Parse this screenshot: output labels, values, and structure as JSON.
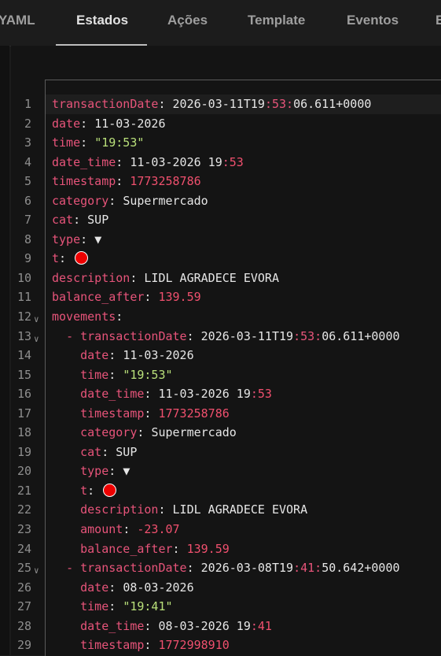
{
  "tabs": [
    {
      "label": "YAML",
      "active": false
    },
    {
      "label": "Estados",
      "active": true
    },
    {
      "label": "Ações",
      "active": false
    },
    {
      "label": "Template",
      "active": false
    },
    {
      "label": "Eventos",
      "active": false
    },
    {
      "label": "E",
      "active": false
    }
  ],
  "colors": {
    "key": "#e7547a",
    "string": "#b9e07a",
    "number": "#f0506e",
    "text": "#e6e6e6",
    "dot": "#ee0000"
  },
  "lines": [
    {
      "n": "1",
      "active": true,
      "tokens": [
        [
          "k",
          "transactionDate"
        ],
        [
          "p",
          ": "
        ],
        [
          "t",
          "2026-03-11T19"
        ],
        [
          "k",
          ":53:"
        ],
        [
          "t",
          "06.611+0000"
        ]
      ]
    },
    {
      "n": "2",
      "tokens": [
        [
          "k",
          "date"
        ],
        [
          "p",
          ": "
        ],
        [
          "t",
          "11-03-2026"
        ]
      ]
    },
    {
      "n": "3",
      "tokens": [
        [
          "k",
          "time"
        ],
        [
          "p",
          ": "
        ],
        [
          "s",
          "\"19:53\""
        ]
      ]
    },
    {
      "n": "4",
      "tokens": [
        [
          "k",
          "date_time"
        ],
        [
          "p",
          ": "
        ],
        [
          "t",
          "11-03-2026 19"
        ],
        [
          "k",
          ":"
        ],
        [
          "n",
          "53"
        ]
      ]
    },
    {
      "n": "5",
      "tokens": [
        [
          "k",
          "timestamp"
        ],
        [
          "p",
          ": "
        ],
        [
          "n",
          "1773258786"
        ]
      ]
    },
    {
      "n": "6",
      "tokens": [
        [
          "k",
          "category"
        ],
        [
          "p",
          ": "
        ],
        [
          "t",
          "Supermercado"
        ]
      ]
    },
    {
      "n": "7",
      "tokens": [
        [
          "k",
          "cat"
        ],
        [
          "p",
          ": "
        ],
        [
          "t",
          "SUP"
        ]
      ]
    },
    {
      "n": "8",
      "tokens": [
        [
          "k",
          "type"
        ],
        [
          "p",
          ": "
        ],
        [
          "t",
          "▼"
        ]
      ]
    },
    {
      "n": "9",
      "tokens": [
        [
          "k",
          "t"
        ],
        [
          "p",
          ": "
        ],
        [
          "dot",
          ""
        ]
      ]
    },
    {
      "n": "10",
      "tokens": [
        [
          "k",
          "description"
        ],
        [
          "p",
          ": "
        ],
        [
          "t",
          "LIDL AGRADECE EVORA"
        ]
      ]
    },
    {
      "n": "11",
      "tokens": [
        [
          "k",
          "balance_after"
        ],
        [
          "p",
          ": "
        ],
        [
          "n",
          "139.59"
        ]
      ]
    },
    {
      "n": "12",
      "fold": true,
      "tokens": [
        [
          "k",
          "movements"
        ],
        [
          "p",
          ":"
        ]
      ]
    },
    {
      "n": "13",
      "fold": true,
      "tokens": [
        [
          "p",
          "  "
        ],
        [
          "dash",
          "- "
        ],
        [
          "k",
          "transactionDate"
        ],
        [
          "p",
          ": "
        ],
        [
          "t",
          "2026-03-11T19"
        ],
        [
          "k",
          ":53:"
        ],
        [
          "t",
          "06.611+0000"
        ]
      ]
    },
    {
      "n": "14",
      "tokens": [
        [
          "p",
          "    "
        ],
        [
          "k",
          "date"
        ],
        [
          "p",
          ": "
        ],
        [
          "t",
          "11-03-2026"
        ]
      ]
    },
    {
      "n": "15",
      "tokens": [
        [
          "p",
          "    "
        ],
        [
          "k",
          "time"
        ],
        [
          "p",
          ": "
        ],
        [
          "s",
          "\"19:53\""
        ]
      ]
    },
    {
      "n": "16",
      "tokens": [
        [
          "p",
          "    "
        ],
        [
          "k",
          "date_time"
        ],
        [
          "p",
          ": "
        ],
        [
          "t",
          "11-03-2026 19"
        ],
        [
          "k",
          ":"
        ],
        [
          "n",
          "53"
        ]
      ]
    },
    {
      "n": "17",
      "tokens": [
        [
          "p",
          "    "
        ],
        [
          "k",
          "timestamp"
        ],
        [
          "p",
          ": "
        ],
        [
          "n",
          "1773258786"
        ]
      ]
    },
    {
      "n": "18",
      "tokens": [
        [
          "p",
          "    "
        ],
        [
          "k",
          "category"
        ],
        [
          "p",
          ": "
        ],
        [
          "t",
          "Supermercado"
        ]
      ]
    },
    {
      "n": "19",
      "tokens": [
        [
          "p",
          "    "
        ],
        [
          "k",
          "cat"
        ],
        [
          "p",
          ": "
        ],
        [
          "t",
          "SUP"
        ]
      ]
    },
    {
      "n": "20",
      "tokens": [
        [
          "p",
          "    "
        ],
        [
          "k",
          "type"
        ],
        [
          "p",
          ": "
        ],
        [
          "t",
          "▼"
        ]
      ]
    },
    {
      "n": "21",
      "tokens": [
        [
          "p",
          "    "
        ],
        [
          "k",
          "t"
        ],
        [
          "p",
          ": "
        ],
        [
          "dot",
          ""
        ]
      ]
    },
    {
      "n": "22",
      "tokens": [
        [
          "p",
          "    "
        ],
        [
          "k",
          "description"
        ],
        [
          "p",
          ": "
        ],
        [
          "t",
          "LIDL AGRADECE EVORA"
        ]
      ]
    },
    {
      "n": "23",
      "tokens": [
        [
          "p",
          "    "
        ],
        [
          "k",
          "amount"
        ],
        [
          "p",
          ": "
        ],
        [
          "n",
          "-23.07"
        ]
      ]
    },
    {
      "n": "24",
      "tokens": [
        [
          "p",
          "    "
        ],
        [
          "k",
          "balance_after"
        ],
        [
          "p",
          ": "
        ],
        [
          "n",
          "139.59"
        ]
      ]
    },
    {
      "n": "25",
      "fold": true,
      "tokens": [
        [
          "p",
          "  "
        ],
        [
          "dash",
          "- "
        ],
        [
          "k",
          "transactionDate"
        ],
        [
          "p",
          ": "
        ],
        [
          "t",
          "2026-03-08T19"
        ],
        [
          "k",
          ":41:"
        ],
        [
          "t",
          "50.642+0000"
        ]
      ]
    },
    {
      "n": "26",
      "tokens": [
        [
          "p",
          "    "
        ],
        [
          "k",
          "date"
        ],
        [
          "p",
          ": "
        ],
        [
          "t",
          "08-03-2026"
        ]
      ]
    },
    {
      "n": "27",
      "tokens": [
        [
          "p",
          "    "
        ],
        [
          "k",
          "time"
        ],
        [
          "p",
          ": "
        ],
        [
          "s",
          "\"19:41\""
        ]
      ]
    },
    {
      "n": "28",
      "tokens": [
        [
          "p",
          "    "
        ],
        [
          "k",
          "date_time"
        ],
        [
          "p",
          ": "
        ],
        [
          "t",
          "08-03-2026 19"
        ],
        [
          "k",
          ":"
        ],
        [
          "n",
          "41"
        ]
      ]
    },
    {
      "n": "29",
      "tokens": [
        [
          "p",
          "    "
        ],
        [
          "k",
          "timestamp"
        ],
        [
          "p",
          ": "
        ],
        [
          "n",
          "1772998910"
        ]
      ]
    }
  ]
}
